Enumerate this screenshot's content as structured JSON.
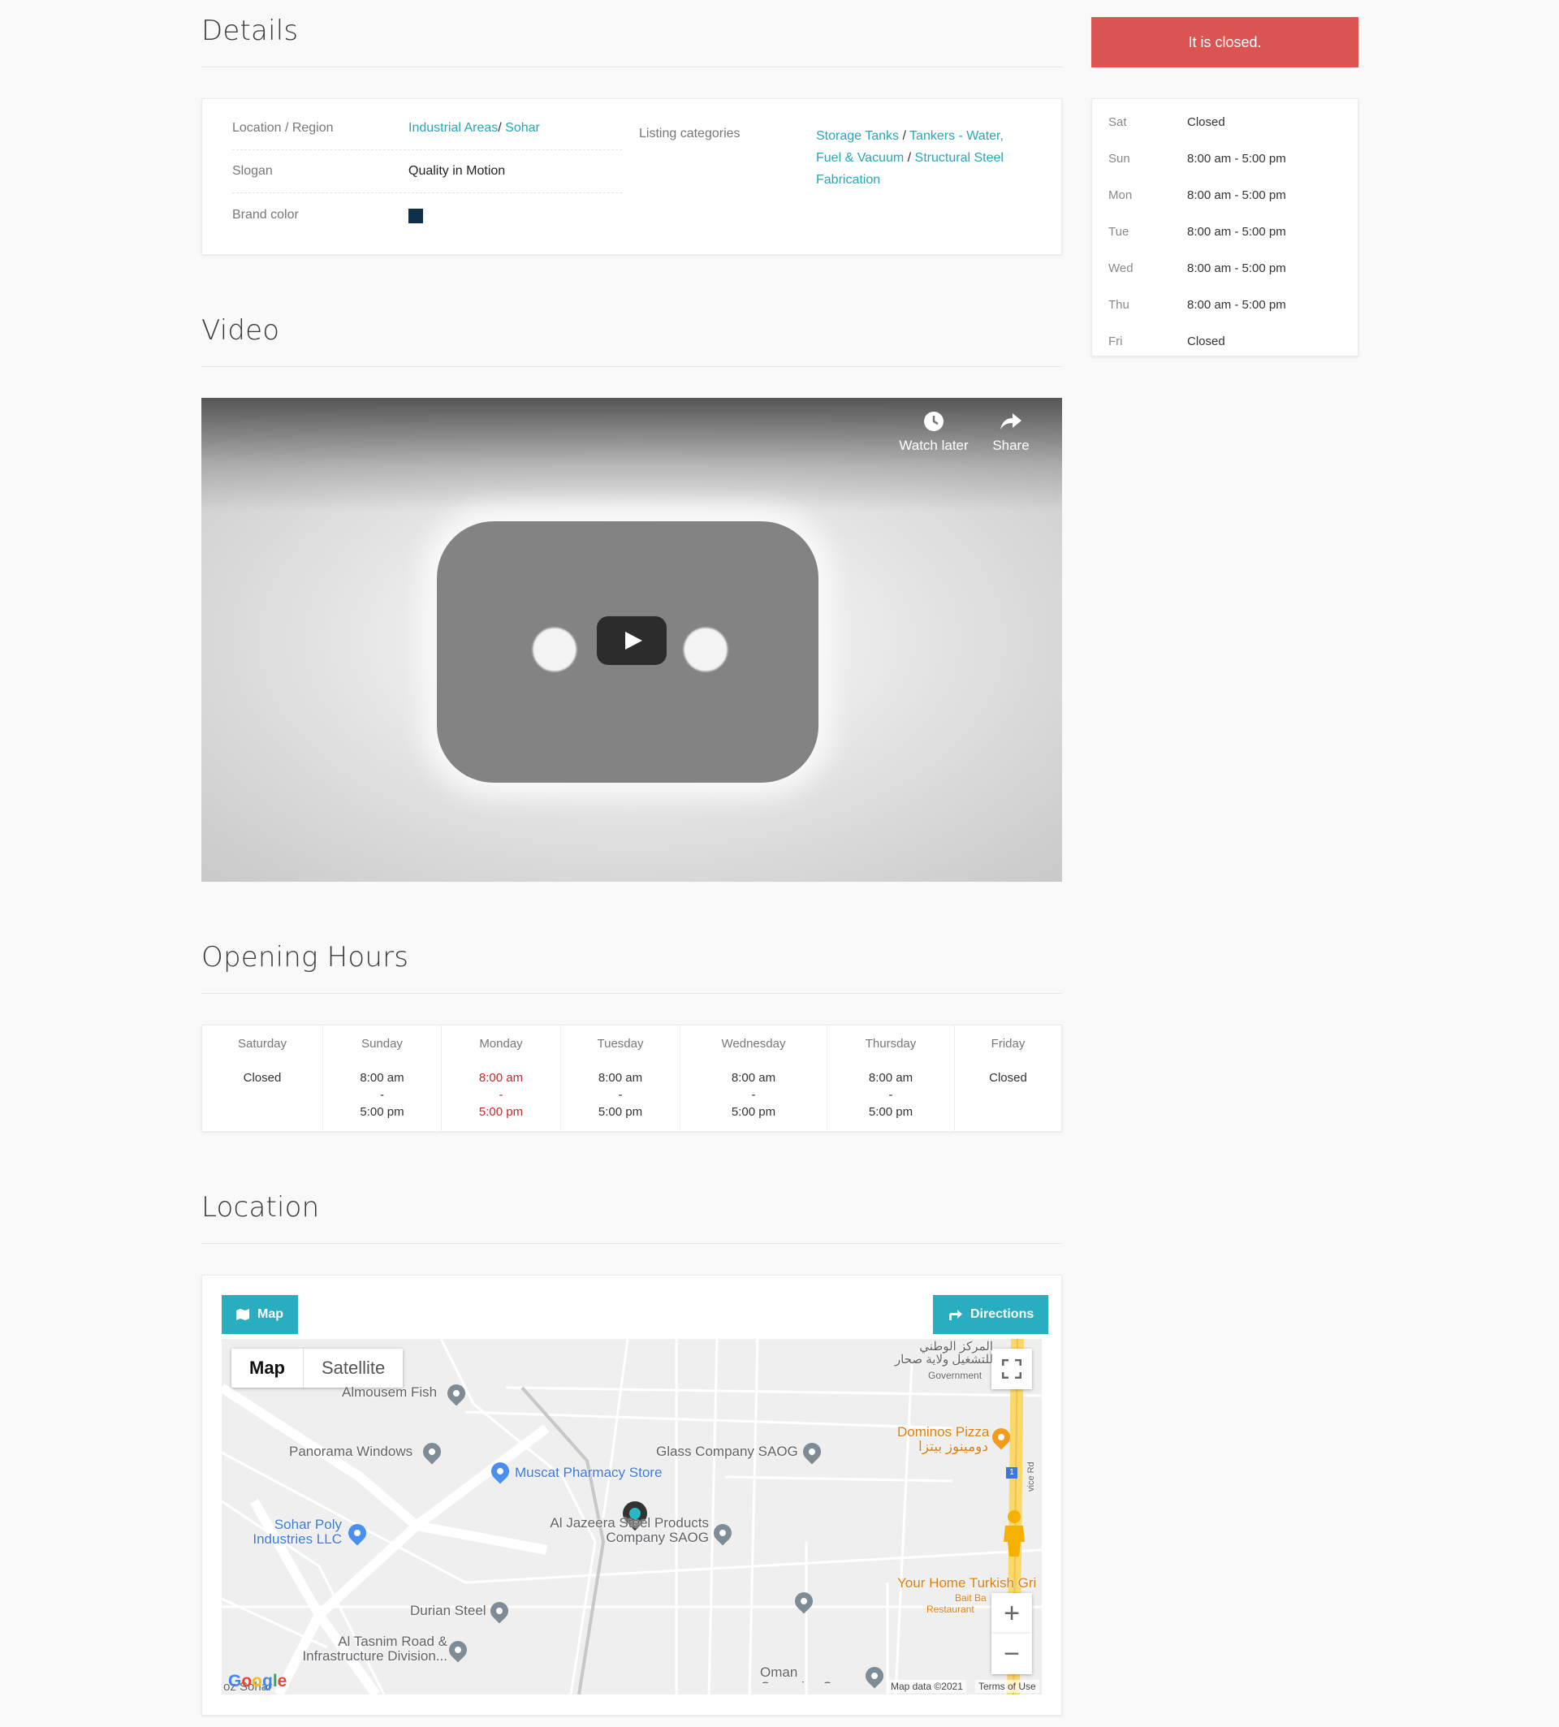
{
  "details": {
    "title": "Details",
    "location_label": "Location / Region",
    "location_region_1": "Industrial Areas",
    "location_region_2": "Sohar",
    "slogan_label": "Slogan",
    "slogan": "Quality in Motion",
    "brand_color_label": "Brand color",
    "brand_color": "#0f3048",
    "categories_label": "Listing categories",
    "categories": [
      "Storage Tanks",
      "Tankers - Water, Fuel & Vacuum",
      "Structural Steel Fabrication"
    ]
  },
  "video": {
    "title": "Video",
    "watch_later": "Watch later",
    "share": "Share"
  },
  "opening_hours": {
    "title": "Opening Hours",
    "days": [
      {
        "day": "Saturday",
        "open": "Closed",
        "dash": "",
        "close": ""
      },
      {
        "day": "Sunday",
        "open": "8:00 am",
        "dash": "-",
        "close": "5:00 pm"
      },
      {
        "day": "Monday",
        "open": "8:00 am",
        "dash": "-",
        "close": "5:00 pm"
      },
      {
        "day": "Tuesday",
        "open": "8:00 am",
        "dash": "-",
        "close": "5:00 pm"
      },
      {
        "day": "Wednesday",
        "open": "8:00 am",
        "dash": "-",
        "close": "5:00 pm"
      },
      {
        "day": "Thursday",
        "open": "8:00 am",
        "dash": "-",
        "close": "5:00 pm"
      },
      {
        "day": "Friday",
        "open": "Closed",
        "dash": "",
        "close": ""
      }
    ],
    "today_color": "#c62828"
  },
  "location": {
    "title": "Location",
    "map_tab": "Map",
    "directions_button": "Directions",
    "map_type_map": "Map",
    "map_type_satellite": "Satellite",
    "pois": {
      "almousem": "Almousem Fish",
      "panorama": "Panorama Windows",
      "muscat_pharmacy": "Muscat Pharmacy Store",
      "glass_company": "Glass Company SAOG",
      "sohar_poly": "Sohar Poly Industries LLC",
      "al_jazeera": "Al Jazeera Steel Products Company SAOG",
      "durian": "Durian Steel",
      "al_tasnim": "Al Tasnim Road & Infrastructure Division...",
      "oman_ceramics": "Oman Ceramics Co SAOG",
      "dominos": "Dominos Pizza",
      "dominos_ar": "دومينوز بيتزا",
      "your_home": "Your Home Turkish Gri",
      "bait_ba": "Bait Ba",
      "restaurant": "Restaurant",
      "government_ar": "المركز الوطني للتشغيل ولاية صحار",
      "government": "Government",
      "sohar_town": "oz Sohar",
      "road_label": "vice Rd",
      "route_number": "1"
    },
    "map_data": "Map data ©2021",
    "terms": "Terms of Use",
    "google": "Google"
  },
  "sidebar": {
    "status": "It is closed.",
    "status_color": "#dc5451",
    "hours": [
      {
        "day": "Sat",
        "time": "Closed"
      },
      {
        "day": "Sun",
        "time": "8:00 am - 5:00 pm"
      },
      {
        "day": "Mon",
        "time": "8:00 am - 5:00 pm"
      },
      {
        "day": "Tue",
        "time": "8:00 am - 5:00 pm"
      },
      {
        "day": "Wed",
        "time": "8:00 am - 5:00 pm"
      },
      {
        "day": "Thu",
        "time": "8:00 am - 5:00 pm"
      },
      {
        "day": "Fri",
        "time": "Closed"
      }
    ]
  }
}
